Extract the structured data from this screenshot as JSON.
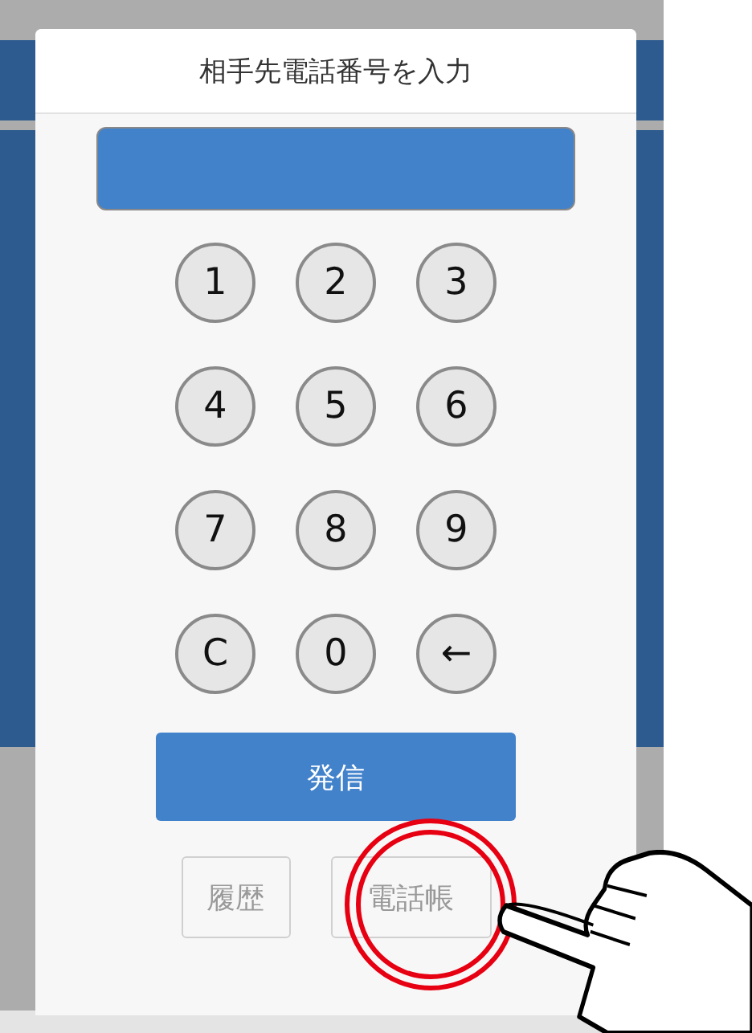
{
  "dialog": {
    "title": "相手先電話番号を入力",
    "keys": [
      "1",
      "2",
      "3",
      "4",
      "5",
      "6",
      "7",
      "8",
      "9",
      "C",
      "0",
      "←"
    ],
    "call_button": "発信",
    "bottom_buttons": [
      "履歴",
      "電話帳"
    ]
  }
}
